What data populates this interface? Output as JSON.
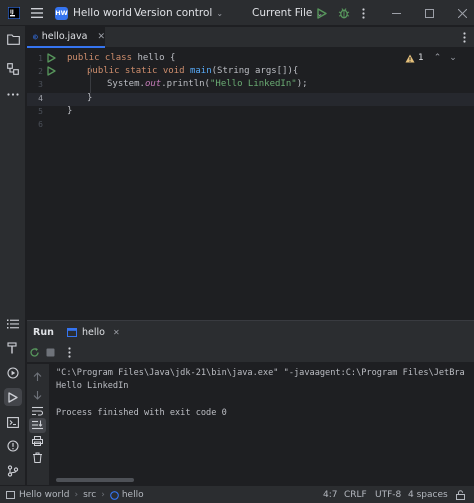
{
  "titlebar": {
    "project_badge": "HW",
    "project_name": "Hello world",
    "vcs_label": "Version control",
    "run_config": "Current File"
  },
  "tab": {
    "filename": "hello.java"
  },
  "editor": {
    "line_numbers": [
      "1",
      "2",
      "3",
      "4",
      "5",
      "6"
    ],
    "inspection_count": "1",
    "code": {
      "l1_kw": "public class ",
      "l1_name": "hello {",
      "l2_kw": "public static void ",
      "l2_fn": "main",
      "l2_rest": "(String args[]){",
      "l3_a": "System.",
      "l3_field": "out",
      "l3_b": ".println(",
      "l3_str": "\"Hello LinkedIn\"",
      "l3_c": ");",
      "l4": "}",
      "l6": "}"
    }
  },
  "run_panel": {
    "title": "Run",
    "config_tab": "hello",
    "console_lines": [
      "\"C:\\Program Files\\Java\\jdk-21\\bin\\java.exe\" \"-javaagent:C:\\Program Files\\JetBra",
      "Hello LinkedIn",
      "",
      "Process finished with exit code 0"
    ]
  },
  "statusbar": {
    "breadcrumb": [
      "Hello world",
      "src",
      "hello"
    ],
    "position": "4:7",
    "line_sep": "CRLF",
    "encoding": "UTF-8",
    "indent": "4 spaces"
  },
  "colors": {
    "accent": "#3574f0",
    "run_green": "#57965c",
    "keyword": "#cf8e6d",
    "function": "#56a8f5",
    "string": "#6aab73",
    "field": "#c77dbb",
    "warning": "#e5c07b"
  }
}
